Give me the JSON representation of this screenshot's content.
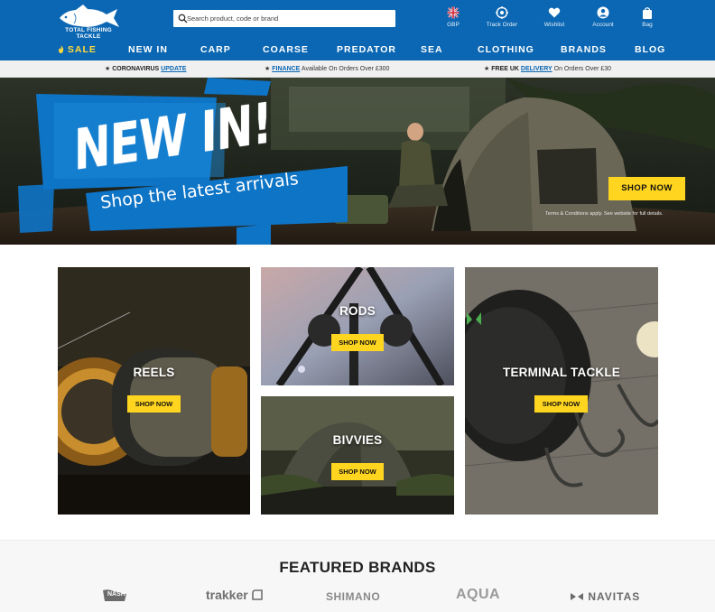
{
  "header": {
    "logo_text": "TOTAL FISHING TACKLE",
    "search_placeholder": "Search product, code or brand",
    "currency_label": "GBP",
    "track_order_label": "Track Order",
    "wishlist_label": "Wishlist",
    "account_label": "Account",
    "bag_label": "Bag"
  },
  "nav": {
    "items": [
      "SALE",
      "NEW IN",
      "CARP",
      "COARSE",
      "PREDATOR",
      "SEA",
      "CLOTHING",
      "BRANDS",
      "BLOG"
    ]
  },
  "strip": {
    "corona_pre": "CORONAVIRUS",
    "corona_link": "UPDATE",
    "finance_link": "FINANCE",
    "finance_rest": "Available On Orders Over £300",
    "delivery_pre": "FREE UK",
    "delivery_link": "DELIVERY",
    "delivery_rest": "On Orders Over £30"
  },
  "hero": {
    "title": "NEW IN!",
    "subtitle": "Shop the latest arrivals",
    "button": "SHOP NOW",
    "terms": "Terms & Conditions apply. See website for full details."
  },
  "tiles": {
    "reels": {
      "title": "REELS",
      "button": "SHOP NOW"
    },
    "rods": {
      "title": "RODS",
      "button": "SHOP NOW"
    },
    "bivvies": {
      "title": "BIVVIES",
      "button": "SHOP NOW"
    },
    "terminal": {
      "title": "TERMINAL TACKLE",
      "button": "SHOP NOW"
    }
  },
  "brands": {
    "title": "FEATURED BRANDS",
    "items": [
      "NASH",
      "trakker",
      "SHIMANO",
      "AQUA",
      "NAVITAS"
    ]
  },
  "colors": {
    "brand_blue": "#0b67b3",
    "accent_yellow": "#ffd51f",
    "sale_yellow": "#ffd93b"
  }
}
